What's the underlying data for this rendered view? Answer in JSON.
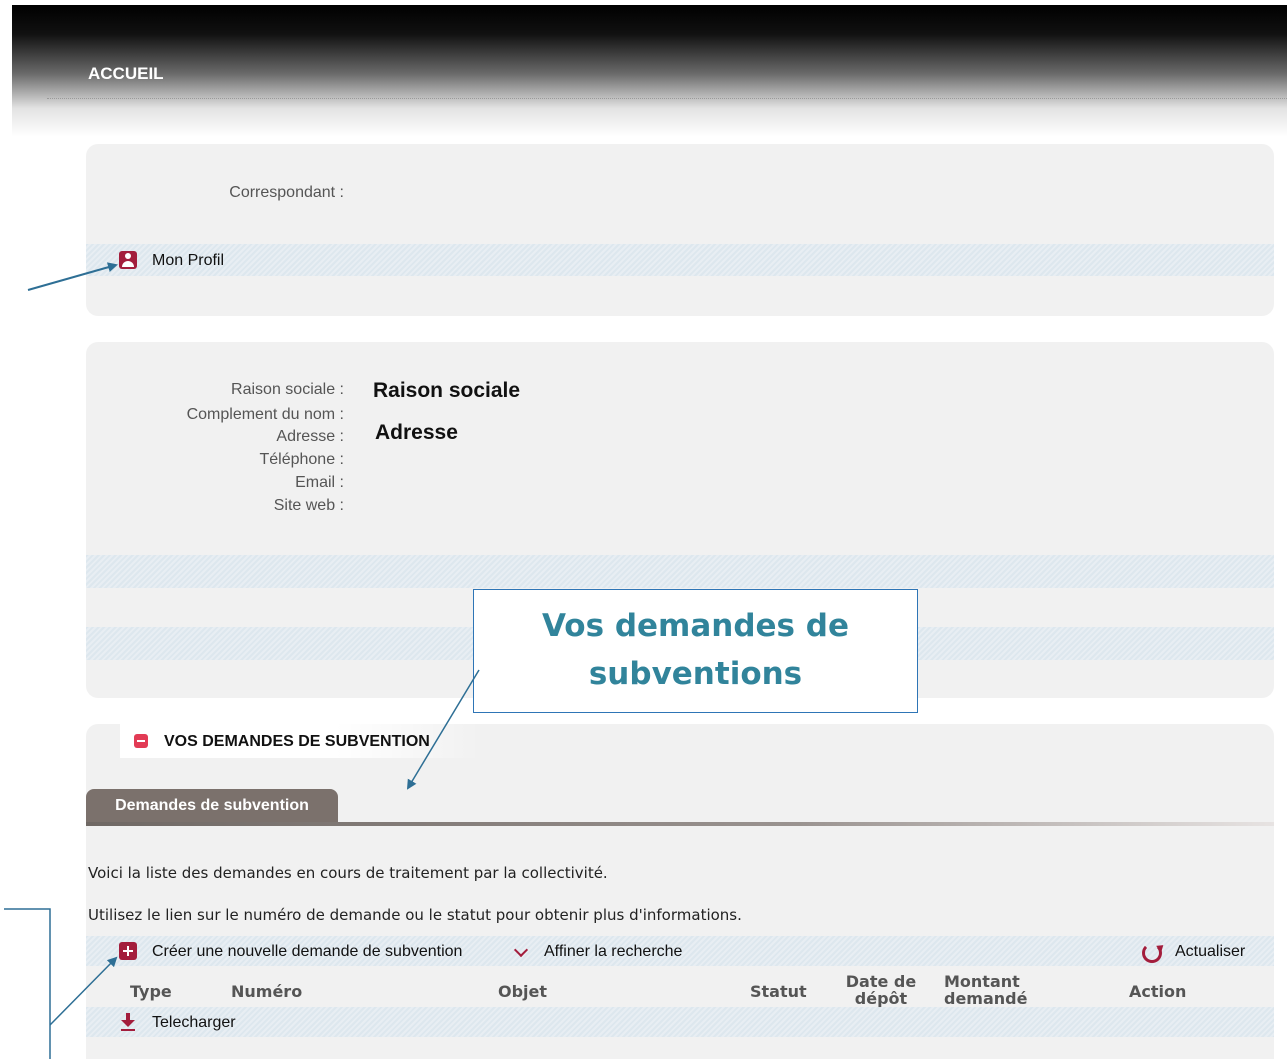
{
  "header": {
    "title": "ACCUEIL"
  },
  "profile_panel": {
    "correspondant_label": "Correspondant :",
    "mon_profil_label": "Mon Profil"
  },
  "org_panel": {
    "raison_sociale_label": "Raison sociale :",
    "raison_sociale_value": "Raison sociale",
    "complement_label": "Complement du nom :",
    "adresse_label": "Adresse :",
    "adresse_value": "Adresse",
    "telephone_label": "Téléphone :",
    "email_label": "Email :",
    "site_web_label": "Site web :"
  },
  "callout": {
    "line1": "Vos demandes de",
    "line2": "subventions"
  },
  "demandes": {
    "section_title": "VOS DEMANDES DE SUBVENTION",
    "tab_label": "Demandes de subvention",
    "info_line1": "Voici la liste des demandes en cours de traitement par la collectivité.",
    "info_line2": "Utilisez le lien sur le numéro de demande ou le statut pour obtenir plus d'informations.",
    "create_label": "Créer une nouvelle demande de subvention",
    "filter_label": "Affiner la recherche",
    "refresh_label": "Actualiser",
    "columns": {
      "type": "Type",
      "numero": "Numéro",
      "objet": "Objet",
      "statut": "Statut",
      "date_line1": "Date de",
      "date_line2": "dépôt",
      "montant_line1": "Montant",
      "montant_line2": "demandé",
      "action": "Action"
    },
    "download_label": "Telecharger"
  },
  "colors": {
    "accent": "#a31d3c",
    "callout_text": "#31849b",
    "arrow": "#2e6f95"
  },
  "icons": [
    "person-icon",
    "plus-icon",
    "minus-icon",
    "chevron-down-icon",
    "refresh-icon",
    "download-icon"
  ]
}
